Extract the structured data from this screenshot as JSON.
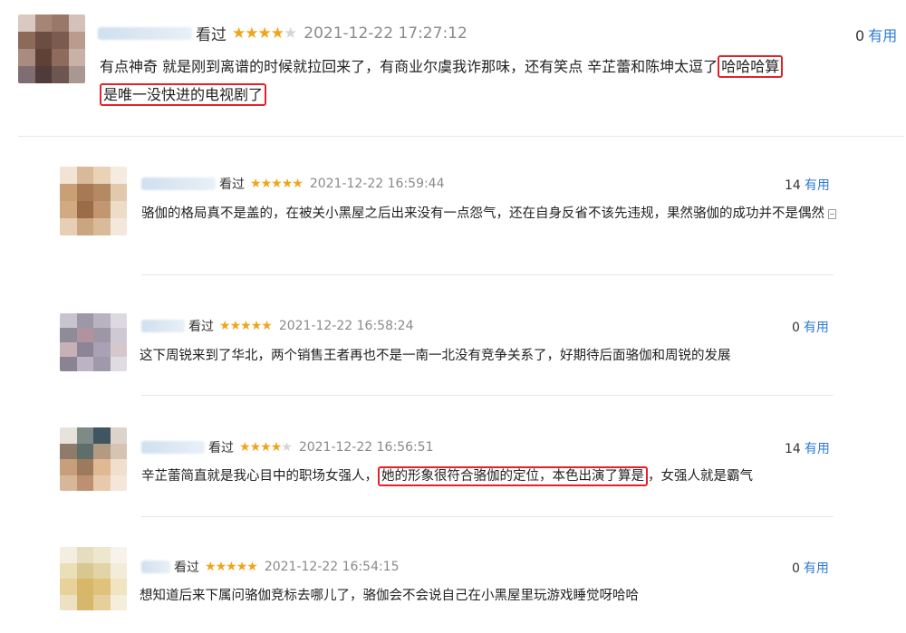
{
  "colors": {
    "accent": "#2e7ad1",
    "star": "#f0a419",
    "highlight_border": "#e3222a"
  },
  "reviews": [
    {
      "watched_label": "看过",
      "stars": 4,
      "timestamp": "2021-12-22 17:27:12",
      "useful_count": "0",
      "useful_label": "有用",
      "text_before": "有点神奇 就是刚到离谱的时候就拉回来了，有商业尔虞我诈那味，还有笑点 辛芷蕾和陈坤太逗了",
      "highlight_1": "哈哈哈算",
      "highlight_2": "是唯一没快进的电视剧了",
      "text_after": ""
    },
    {
      "watched_label": "看过",
      "stars": 5,
      "timestamp": "2021-12-22 16:59:44",
      "useful_count": "14",
      "useful_label": "有用",
      "text": "骆伽的格局真不是盖的，在被关小黑屋之后出来没有一点怨气，还在自身反省不该先违规，果然骆伽的成功并不是偶然"
    },
    {
      "watched_label": "看过",
      "stars": 5,
      "timestamp": "2021-12-22 16:58:24",
      "useful_count": "0",
      "useful_label": "有用",
      "text": "这下周锐来到了华北，两个销售王者再也不是一南一北没有竞争关系了，好期待后面骆伽和周锐的发展"
    },
    {
      "watched_label": "看过",
      "stars": 4,
      "timestamp": "2021-12-22 16:56:51",
      "useful_count": "14",
      "useful_label": "有用",
      "text_before": "辛芷蕾简直就是我心目中的职场女强人，",
      "highlight": "她的形象很符合骆伽的定位，本色出演了算是",
      "text_after": "，女强人就是霸气"
    },
    {
      "watched_label": "看过",
      "stars": 5,
      "timestamp": "2021-12-22 16:54:15",
      "useful_count": "0",
      "useful_label": "有用",
      "text": "想知道后来下属问骆伽竞标去哪儿了，骆伽会不会说自己在小黑屋里玩游戏睡觉呀哈哈"
    }
  ]
}
